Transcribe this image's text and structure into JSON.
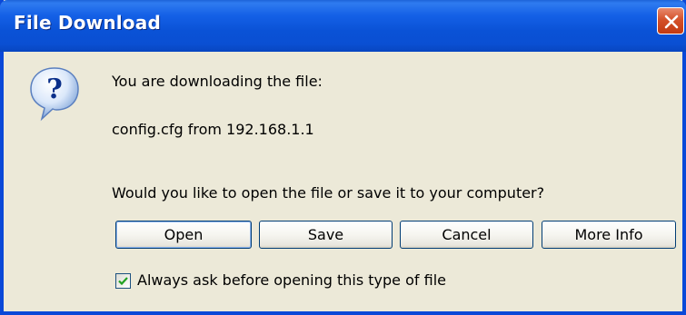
{
  "window": {
    "title": "File Download",
    "colors": {
      "titlebar": "#0a52d6",
      "frame": "#0a48d8",
      "body": "#ece9d8",
      "close": "#d4512a"
    }
  },
  "icons": {
    "dialog": "question-icon",
    "close": "close-icon",
    "check": "checkmark-icon"
  },
  "message": {
    "line1": "You are downloading the file:",
    "line2": "config.cfg from 192.168.1.1",
    "line3": "Would you like to open the file or save it to your computer?"
  },
  "buttons": {
    "open": "Open",
    "save": "Save",
    "cancel": "Cancel",
    "more_info": "More Info"
  },
  "checkbox": {
    "label": "Always ask before opening this type of file",
    "checked": true
  }
}
